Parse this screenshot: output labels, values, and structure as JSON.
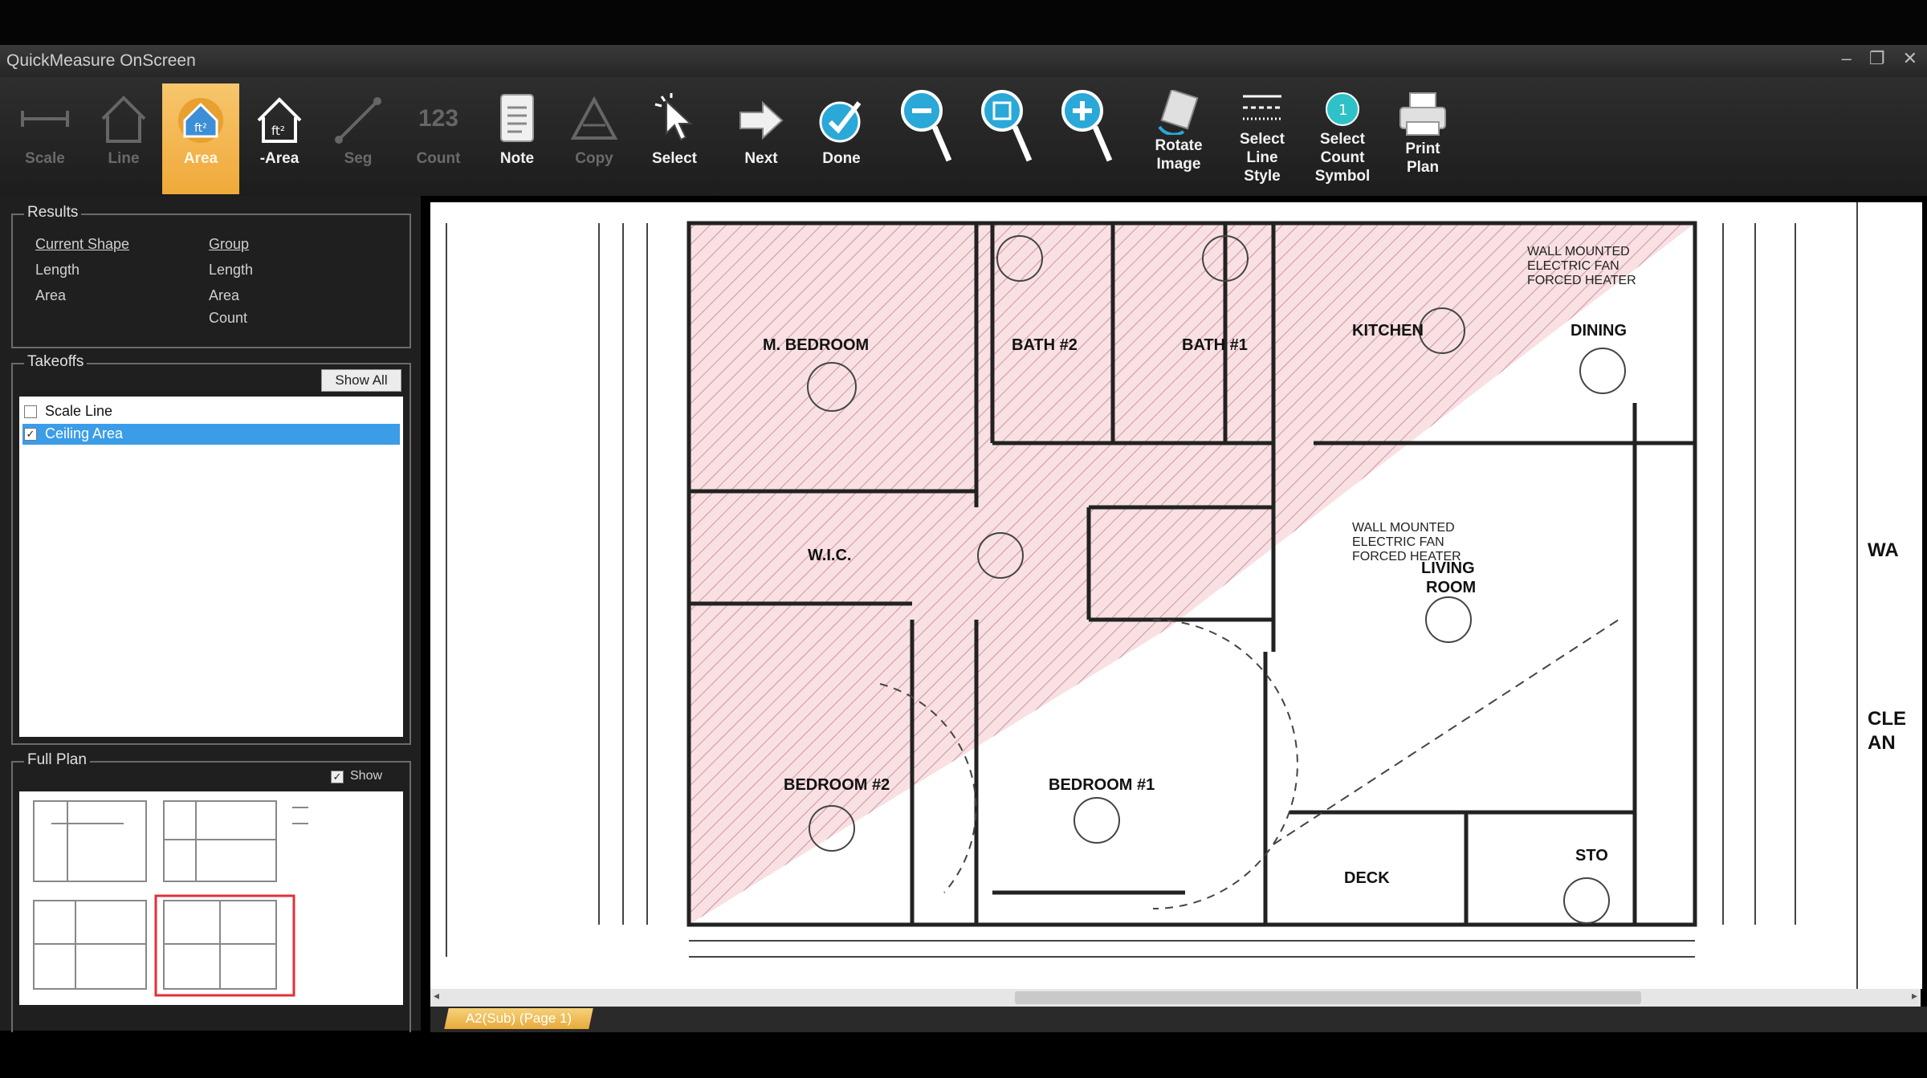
{
  "window": {
    "title": "QuickMeasure OnScreen"
  },
  "toolbar": {
    "scale": "Scale",
    "line": "Line",
    "plus_area": "Area",
    "minus_area": "-Area",
    "seg": "Seg",
    "count": "Count",
    "count_icon": "123",
    "note": "Note",
    "copy": "Copy",
    "select": "Select",
    "next": "Next",
    "done": "Done",
    "rotate_l1": "Rotate",
    "rotate_l2": "Image",
    "sls_l1": "Select",
    "sls_l2": "Line",
    "sls_l3": "Style",
    "scs_l1": "Select",
    "scs_l2": "Count",
    "scs_l3": "Symbol",
    "print_l1": "Print",
    "print_l2": "Plan",
    "active_color": "#f0a93a"
  },
  "results": {
    "title": "Results",
    "current_shape": "Current Shape",
    "group": "Group",
    "length": "Length",
    "area": "Area",
    "count": "Count"
  },
  "takeoffs": {
    "title": "Takeoffs",
    "show_all": "Show All",
    "items": [
      {
        "label": "Scale Line",
        "checked": false
      },
      {
        "label": "Ceiling Area",
        "checked": true
      }
    ]
  },
  "fullplan": {
    "title": "Full Plan",
    "show": "Show"
  },
  "plan": {
    "rooms": {
      "mbedroom": "M. BEDROOM",
      "bath2": "BATH #2",
      "bath1": "BATH #1",
      "kitchen": "KITCHEN",
      "dining": "DINING",
      "living1": "LIVING",
      "living2": "ROOM",
      "bedroom2": "BEDROOM #2",
      "bedroom1": "BEDROOM #1",
      "deck": "DECK",
      "sto": "STO",
      "wic": "W.I.C."
    },
    "notes": {
      "wm1": "WALL MOUNTED",
      "wm2": "ELECTRIC FAN",
      "wm3": "FORCED HEATER"
    },
    "hatch_color": "#f2c7cc"
  },
  "right_strip": {
    "t1": "WA",
    "t2": "CLE",
    "t3": "AN"
  },
  "tab": {
    "label": "A2(Sub) (Page 1)"
  }
}
